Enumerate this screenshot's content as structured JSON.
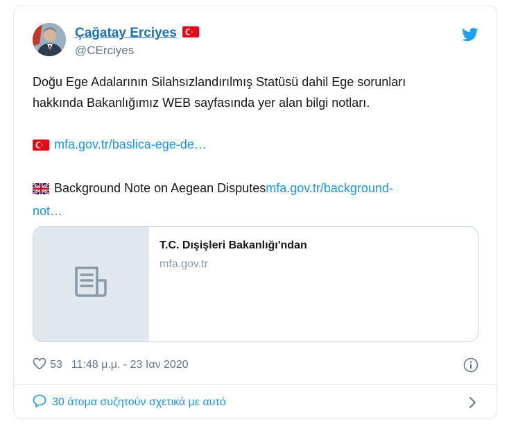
{
  "author": {
    "display_name": "Çağatay Erciyes",
    "handle": "@CErciyes"
  },
  "icons": {
    "author_flag": "turkey-flag-icon",
    "brand": "twitter-bird-icon",
    "brand_color": "#1da1f2"
  },
  "tweet": {
    "line1": "Doğu Ege Adalarının Silahsızlandırılmış Statüsü dahil Ege sorunları",
    "line2": "hakkında Bakanlığımız WEB sayfasında yer alan bilgi notları.",
    "link_tr": "mfa.gov.tr/baslica-ege-de…",
    "en_text": "Background Note on Aegean Disputes",
    "link_en_part1": "mfa.gov.tr/background-",
    "link_en_part2": "not…"
  },
  "card": {
    "title": "T.C. Dışişleri Bakanlığı'ndan",
    "domain": "mfa.gov.tr"
  },
  "meta": {
    "like_count": "53",
    "timestamp": "11:48 μ.μ. - 23 Ιαν 2020"
  },
  "discussion": {
    "label": "30 άτομα συζητούν σχετικά με αυτό"
  }
}
